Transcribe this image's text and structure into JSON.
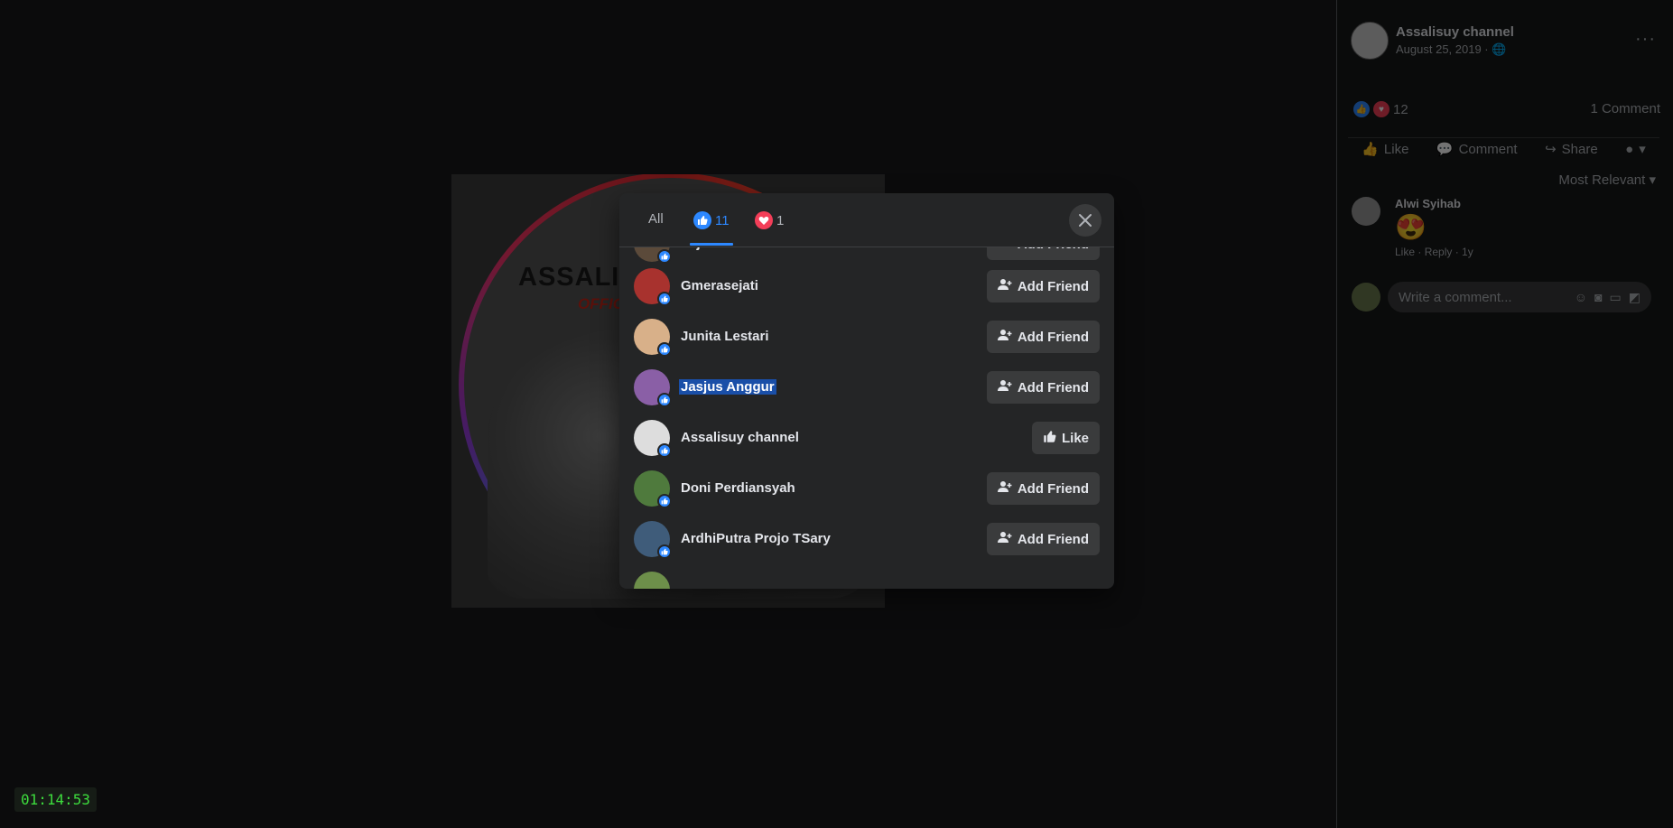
{
  "photo": {
    "brand_text": "ASSALI",
    "brand_sub": "OFFIC"
  },
  "post": {
    "author": "Assalisuy channel",
    "date": "August 25, 2019 · ",
    "reaction_count": "12",
    "comments_count": "1 Comment",
    "actions": {
      "like": "Like",
      "comment": "Comment",
      "share": "Share"
    },
    "sort_label": "Most Relevant"
  },
  "comment": {
    "author": "Alwi Syihab",
    "emoji": "😍",
    "like": "Like",
    "reply": "Reply",
    "age": "1y"
  },
  "write_comment": {
    "placeholder": "Write a comment..."
  },
  "modal": {
    "tabs": {
      "all": "All",
      "like_count": "11",
      "love_count": "1"
    },
    "rows": [
      {
        "name": "Fajri Anoemaa",
        "button": "Add Friend",
        "color": "#5b4a3a"
      },
      {
        "name": "Gmerasejati",
        "button": "Add Friend",
        "color": "#a8322e"
      },
      {
        "name": "Junita Lestari",
        "button": "Add Friend",
        "color": "#d8b089"
      },
      {
        "name": "Jasjus Anggur",
        "button": "Add Friend",
        "color": "#8a5fa6",
        "selected": true
      },
      {
        "name": "Assalisuy channel",
        "button": "Like",
        "color": "#dddddd"
      },
      {
        "name": "Doni Perdiansyah",
        "button": "Add Friend",
        "color": "#4f7a3d"
      },
      {
        "name": "ArdhiPutra Projo TSary",
        "button": "Add Friend",
        "color": "#3f5c7a"
      },
      {
        "name": "",
        "button": "",
        "color": "#6d8f4a"
      }
    ]
  },
  "timer": "01:14:53"
}
